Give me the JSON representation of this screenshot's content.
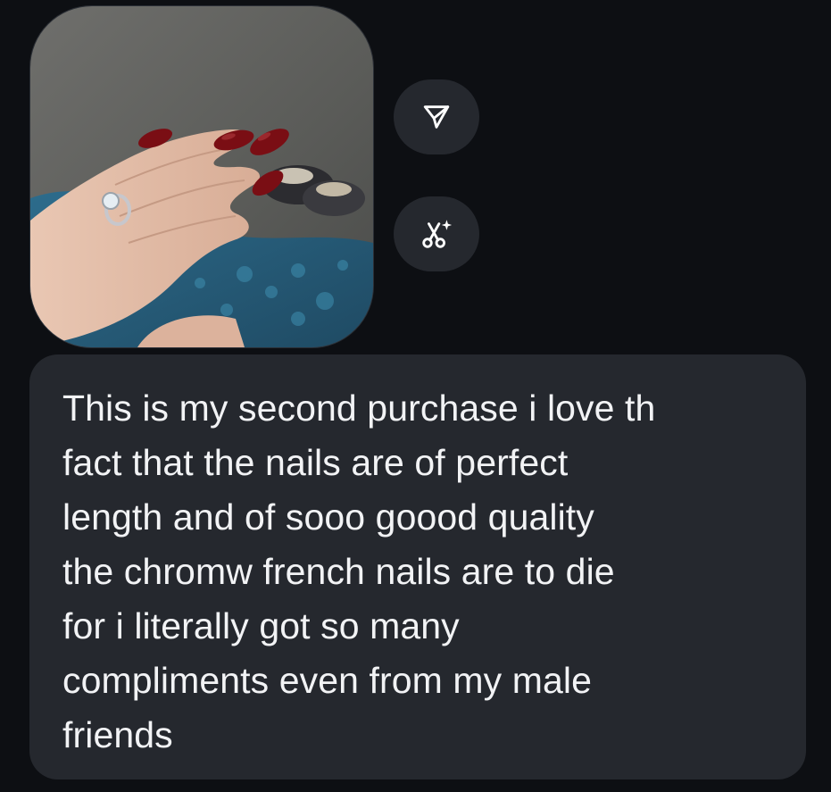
{
  "conversation": {
    "attachment": {
      "kind": "photo",
      "subject": "hand with dark red almond nails"
    },
    "actions": [
      {
        "name": "share",
        "icon": "send-icon"
      },
      {
        "name": "edit-ai",
        "icon": "scissors-sparkle-icon"
      }
    ],
    "message": {
      "text": "This is my second purchase i love th\nfact that the nails are of perfect\nlength and of sooo goood quality\nthe chromw french nails are to die\nfor i literally got so many\ncompliments even from my male\nfriends"
    }
  },
  "colors": {
    "background": "#0d0f13",
    "bubble": "#25282e",
    "text": "#f2f3f5",
    "nail": "#7a0e14"
  }
}
